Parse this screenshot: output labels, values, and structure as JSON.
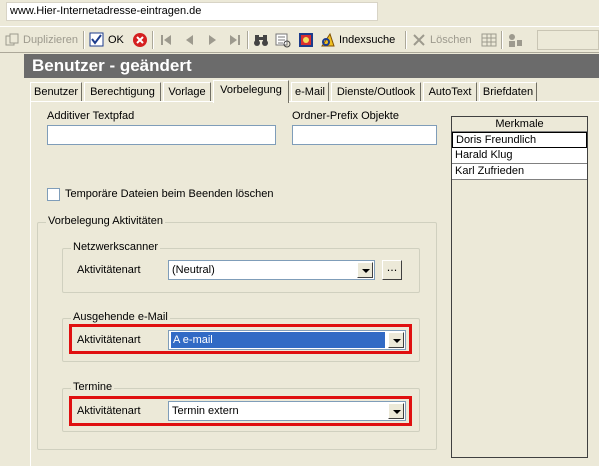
{
  "url": "www.Hier-Internetadresse-eintragen.de",
  "toolbar": {
    "duplizieren": "Duplizieren",
    "ok": "OK",
    "indexsuche": "Indexsuche",
    "loeschen": "Löschen"
  },
  "title": "Benutzer - geändert",
  "tabs": [
    "Benutzer",
    "Berechtigung",
    "Vorlage",
    "Vorbelegung",
    "e-Mail",
    "Dienste/Outlook",
    "AutoText",
    "Briefdaten"
  ],
  "active_tab": "Vorbelegung",
  "fields": {
    "additiver_textpfad_label": "Additiver Textpfad",
    "additiver_textpfad_value": "",
    "ordner_prefix_label": "Ordner-Prefix Objekte",
    "ordner_prefix_value": "",
    "temp_checkbox_label": "Temporäre Dateien beim Beenden löschen",
    "temp_checkbox_checked": false
  },
  "vorbelegung": {
    "group_title": "Vorbelegung Aktivitäten",
    "netzwerkscanner": {
      "title": "Netzwerkscanner",
      "label": "Aktivitätenart",
      "value": "(Neutral)",
      "dots": "..."
    },
    "email": {
      "title": "Ausgehende e-Mail",
      "label": "Aktivitätenart",
      "value": "A e-mail"
    },
    "termine": {
      "title": "Termine",
      "label": "Aktivitätenart",
      "value": "Termin extern"
    }
  },
  "merkmale": {
    "header": "Merkmale",
    "items": [
      "Doris Freundlich",
      "Harald Klug",
      "Karl Zufrieden"
    ]
  },
  "colors": {
    "highlight": "#e01010",
    "selection": "#316ac5",
    "title_bg": "#6b6b6b"
  }
}
